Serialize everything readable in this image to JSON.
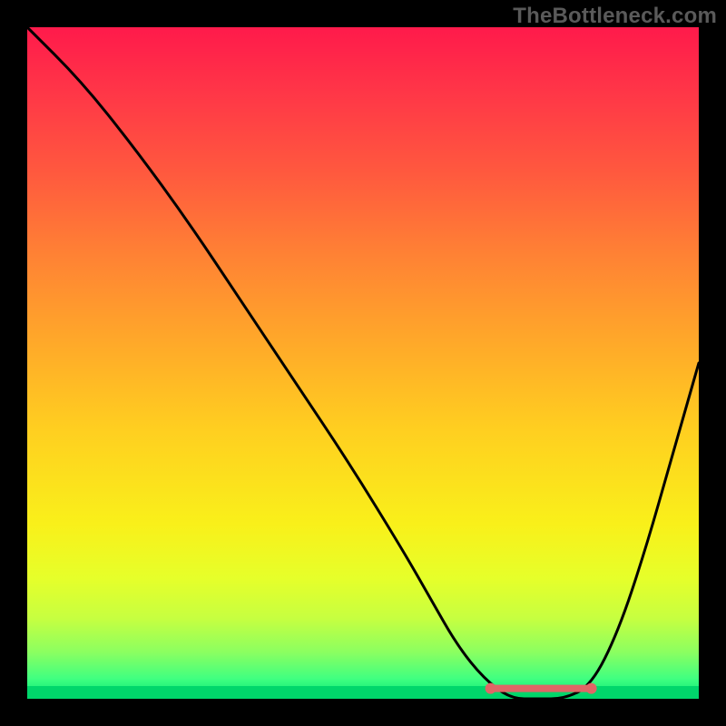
{
  "watermark": "TheBottleneck.com",
  "chart_data": {
    "type": "line",
    "title": "",
    "xlabel": "",
    "ylabel": "",
    "xlim": [
      0,
      100
    ],
    "ylim": [
      0,
      100
    ],
    "grid": false,
    "legend": false,
    "series": [
      {
        "name": "bottleneck-curve",
        "color": "#000000",
        "x": [
          0,
          8,
          16,
          24,
          32,
          40,
          48,
          56,
          60,
          64,
          68,
          72,
          76,
          80,
          84,
          88,
          92,
          96,
          100
        ],
        "values": [
          100,
          92,
          82,
          71,
          59,
          47,
          35,
          22,
          15,
          8,
          3,
          0,
          0,
          0,
          2,
          10,
          22,
          36,
          50
        ]
      }
    ],
    "annotations": [
      {
        "name": "flat-pink-segment",
        "type": "segment",
        "color": "#e06666",
        "x_range": [
          69,
          84
        ],
        "y": 1
      }
    ],
    "background_gradient": {
      "stops": [
        {
          "pos": 0.0,
          "color": "#ff1a4b"
        },
        {
          "pos": 0.22,
          "color": "#ff5a3e"
        },
        {
          "pos": 0.46,
          "color": "#ffa62a"
        },
        {
          "pos": 0.74,
          "color": "#f9f01a"
        },
        {
          "pos": 0.93,
          "color": "#8cff60"
        },
        {
          "pos": 1.0,
          "color": "#00e676"
        }
      ]
    }
  }
}
